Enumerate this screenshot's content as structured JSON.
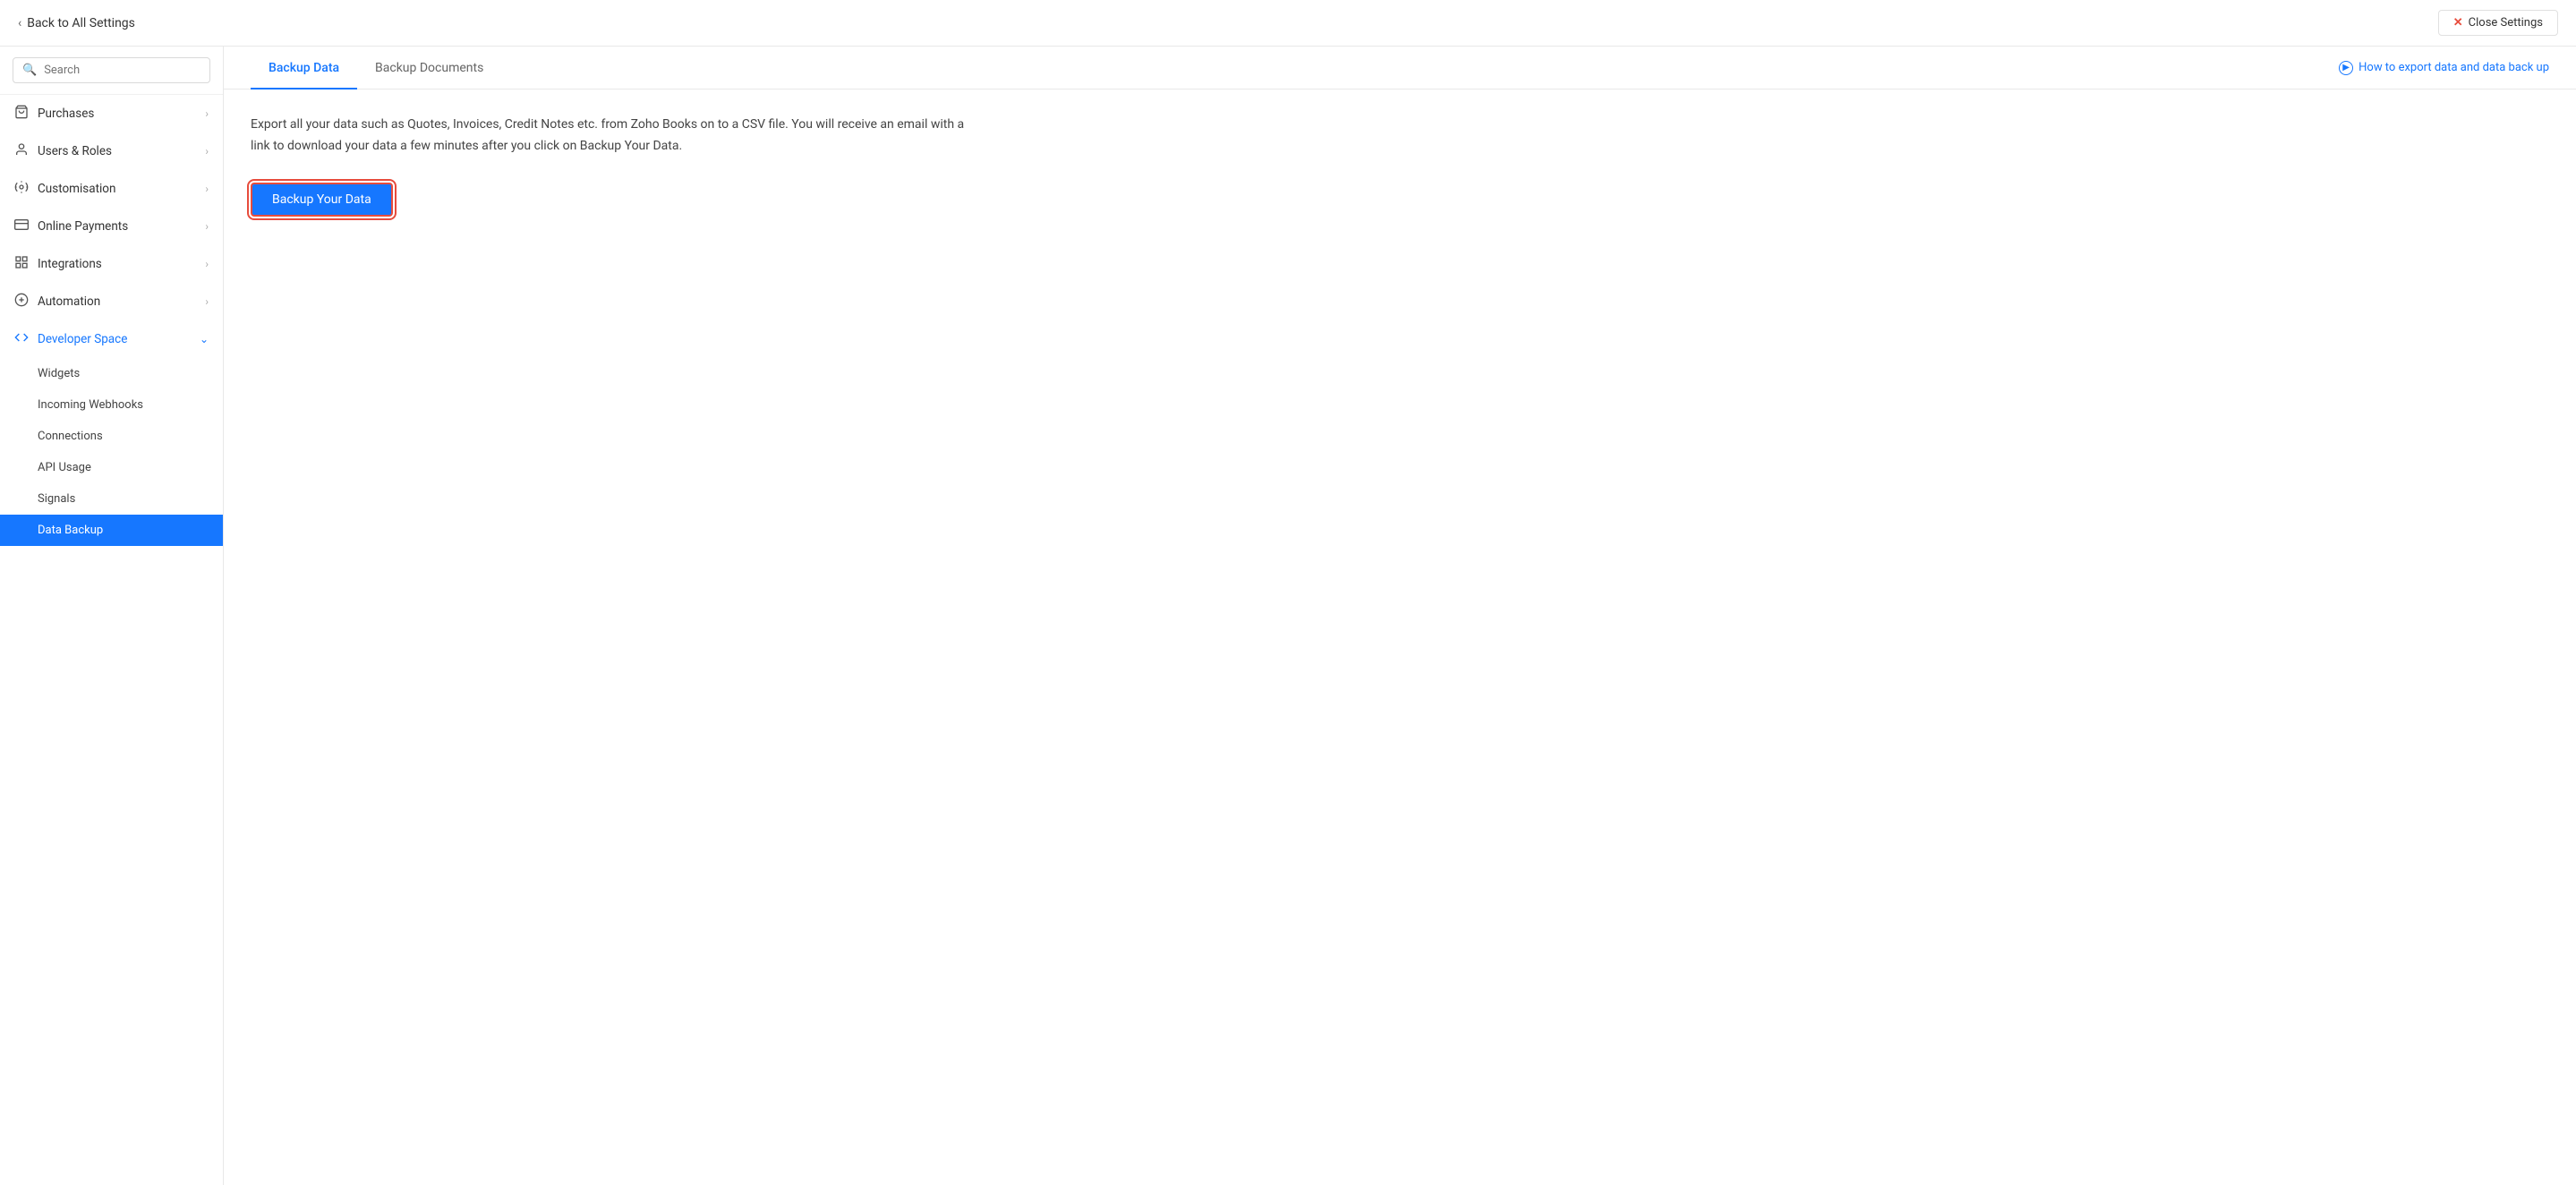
{
  "topBar": {
    "backLabel": "Back to All Settings",
    "closeLabel": "Close Settings"
  },
  "sidebar": {
    "searchPlaceholder": "Search",
    "navItems": [
      {
        "id": "purchases",
        "label": "Purchases",
        "icon": "bag",
        "hasChevron": true
      },
      {
        "id": "users-roles",
        "label": "Users & Roles",
        "icon": "person",
        "hasChevron": true
      },
      {
        "id": "customisation",
        "label": "Customisation",
        "icon": "grid",
        "hasChevron": true
      },
      {
        "id": "online-payments",
        "label": "Online Payments",
        "icon": "card",
        "hasChevron": true
      },
      {
        "id": "integrations",
        "label": "Integrations",
        "icon": "box",
        "hasChevron": true
      },
      {
        "id": "automation",
        "label": "Automation",
        "icon": "plus-circle",
        "hasChevron": true
      },
      {
        "id": "developer-space",
        "label": "Developer Space",
        "icon": "code",
        "hasChevron": true,
        "isBlue": true,
        "expanded": true
      }
    ],
    "subItems": [
      {
        "id": "widgets",
        "label": "Widgets"
      },
      {
        "id": "incoming-webhooks",
        "label": "Incoming Webhooks"
      },
      {
        "id": "connections",
        "label": "Connections"
      },
      {
        "id": "api-usage",
        "label": "API Usage"
      },
      {
        "id": "signals",
        "label": "Signals"
      },
      {
        "id": "data-backup",
        "label": "Data Backup",
        "active": true
      }
    ]
  },
  "tabs": [
    {
      "id": "backup-data",
      "label": "Backup Data",
      "active": true
    },
    {
      "id": "backup-documents",
      "label": "Backup Documents",
      "active": false
    }
  ],
  "howToLink": "How to export data and data back up",
  "content": {
    "description": "Export all your data such as Quotes, Invoices, Credit Notes etc. from Zoho Books on to a CSV file. You will receive an email with a link to download your data a few minutes after you click on Backup Your Data.",
    "backupButtonLabel": "Backup Your Data"
  }
}
